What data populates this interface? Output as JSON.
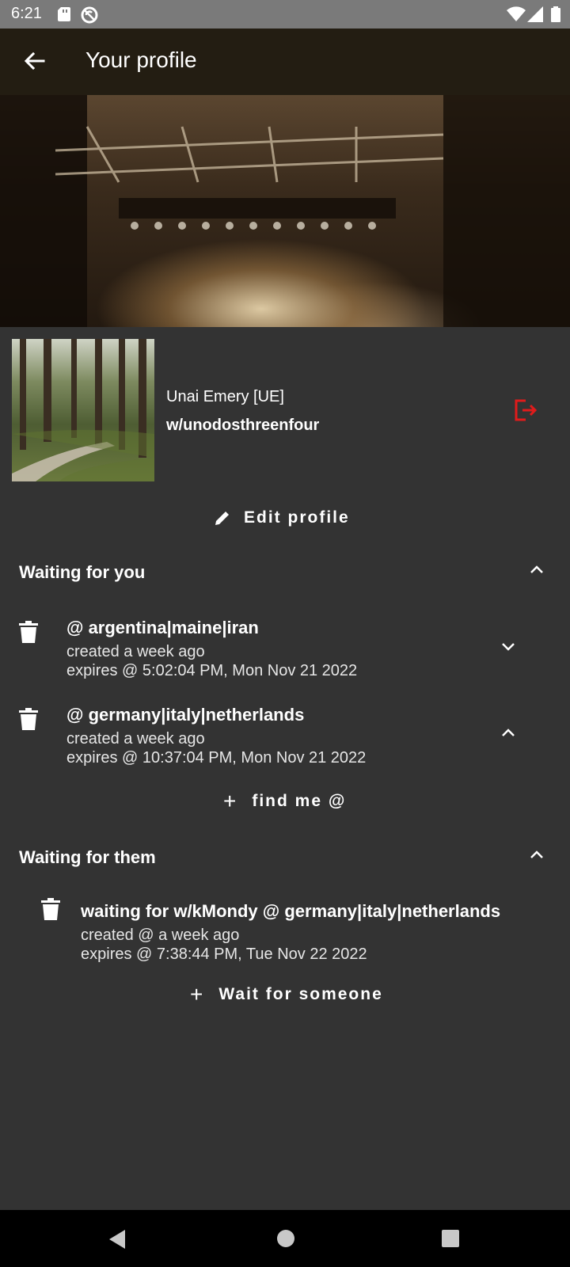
{
  "status_bar": {
    "time": "6:21"
  },
  "app_bar": {
    "title": "Your profile"
  },
  "profile": {
    "name": "Unai Emery [UE]",
    "handle": "w/unodosthreenfour",
    "edit_label": "Edit profile"
  },
  "waiting_for_you": {
    "title": "Waiting for you",
    "items": [
      {
        "title": "@ argentina|maine|iran",
        "created": "created a week ago",
        "expires": "expires @ 5:02:04 PM, Mon Nov 21 2022"
      },
      {
        "title": "@ germany|italy|netherlands",
        "created": "created a week ago",
        "expires": "expires @ 10:37:04 PM, Mon Nov 21 2022"
      }
    ],
    "add_label": "find me @"
  },
  "waiting_for_them": {
    "title": "Waiting for them",
    "items": [
      {
        "title": "waiting for w/kMondy @ germany|italy|netherlands",
        "created": "created @ a week ago",
        "expires": "expires @ 7:38:44 PM, Tue Nov 22 2022"
      }
    ],
    "add_label": "Wait for someone"
  },
  "colors": {
    "accent_logout": "#e01b1b",
    "app_bar_bg": "#231d12",
    "background": "#333333"
  },
  "icons": [
    "back-arrow-icon",
    "logout-icon",
    "pencil-icon",
    "trash-icon",
    "chevron-up-icon",
    "chevron-down-icon",
    "plus-icon"
  ]
}
